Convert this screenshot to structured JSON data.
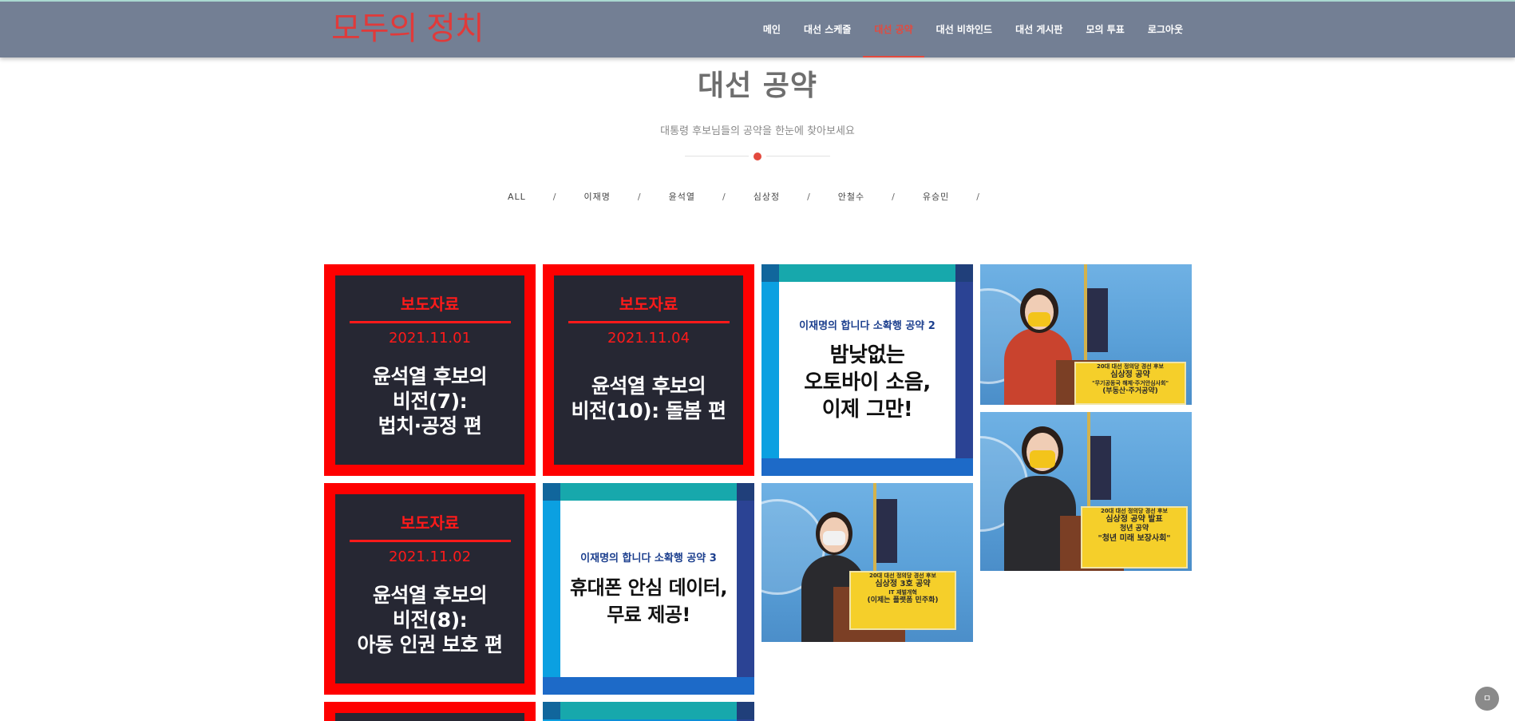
{
  "header": {
    "logo": "모두의 정치",
    "nav": [
      "메인",
      "대선 스케줄",
      "대선 공약",
      "대선 비하인드",
      "대선 게시판",
      "모의 투표",
      "로그아웃"
    ],
    "active_nav": "대선 공약"
  },
  "section": {
    "title": "대선 공약",
    "subtitle": "대통령 후보님들의 공약을 한눈에 찾아보세요"
  },
  "filters": [
    "ALL",
    "이재명",
    "윤석열",
    "심상정",
    "안철수",
    "유승민"
  ],
  "press": [
    {
      "title": "보도자료",
      "date": "2021.11.01",
      "text": "윤석열 후보의\n비전(7):\n법치·공정 편"
    },
    {
      "title": "보도자료",
      "date": "2021.11.04",
      "text": "윤석열 후보의\n비전(10): 돌봄 편"
    },
    {
      "title": "보도자료",
      "date": "2021.11.02",
      "text": "윤석열 후보의\n비전(8):\n아동 인권 보호 편"
    }
  ],
  "cards": [
    {
      "subtitle": "이재명의 합니다 소확행 공약 2",
      "text": "밤낮없는\n오토바이 소음,\n이제 그만!"
    },
    {
      "subtitle": "이재명의 합니다 소확행 공약 3",
      "text": "휴대폰 안심 데이터,\n무료 제공!"
    }
  ],
  "photos": [
    {
      "l1": "20대 대선 정의당 경선 후보",
      "l2": "심상정 공약",
      "l3": "\"무기공동국 해제·주거안심사회\"",
      "l4": "(부동산·주거공약)"
    },
    {
      "l1": "20대 대선 정의당 경선 후보",
      "l2": "심상정 3호 공약",
      "l3": "IT 재벌개혁",
      "l4": "(이제는 플랫폼 민주화)"
    },
    {
      "l1": "20대 대선 정의당 경선 후보",
      "l2": "심상정 공약 발표",
      "l3": "청년 공약",
      "l4": "\"청년 미래 보장사회\""
    }
  ],
  "float_button": "ㅁ",
  "colors": {
    "header": "#737f94",
    "accent": "#e34a3e",
    "press_red": "#fe0000",
    "press_dark": "#262733"
  }
}
